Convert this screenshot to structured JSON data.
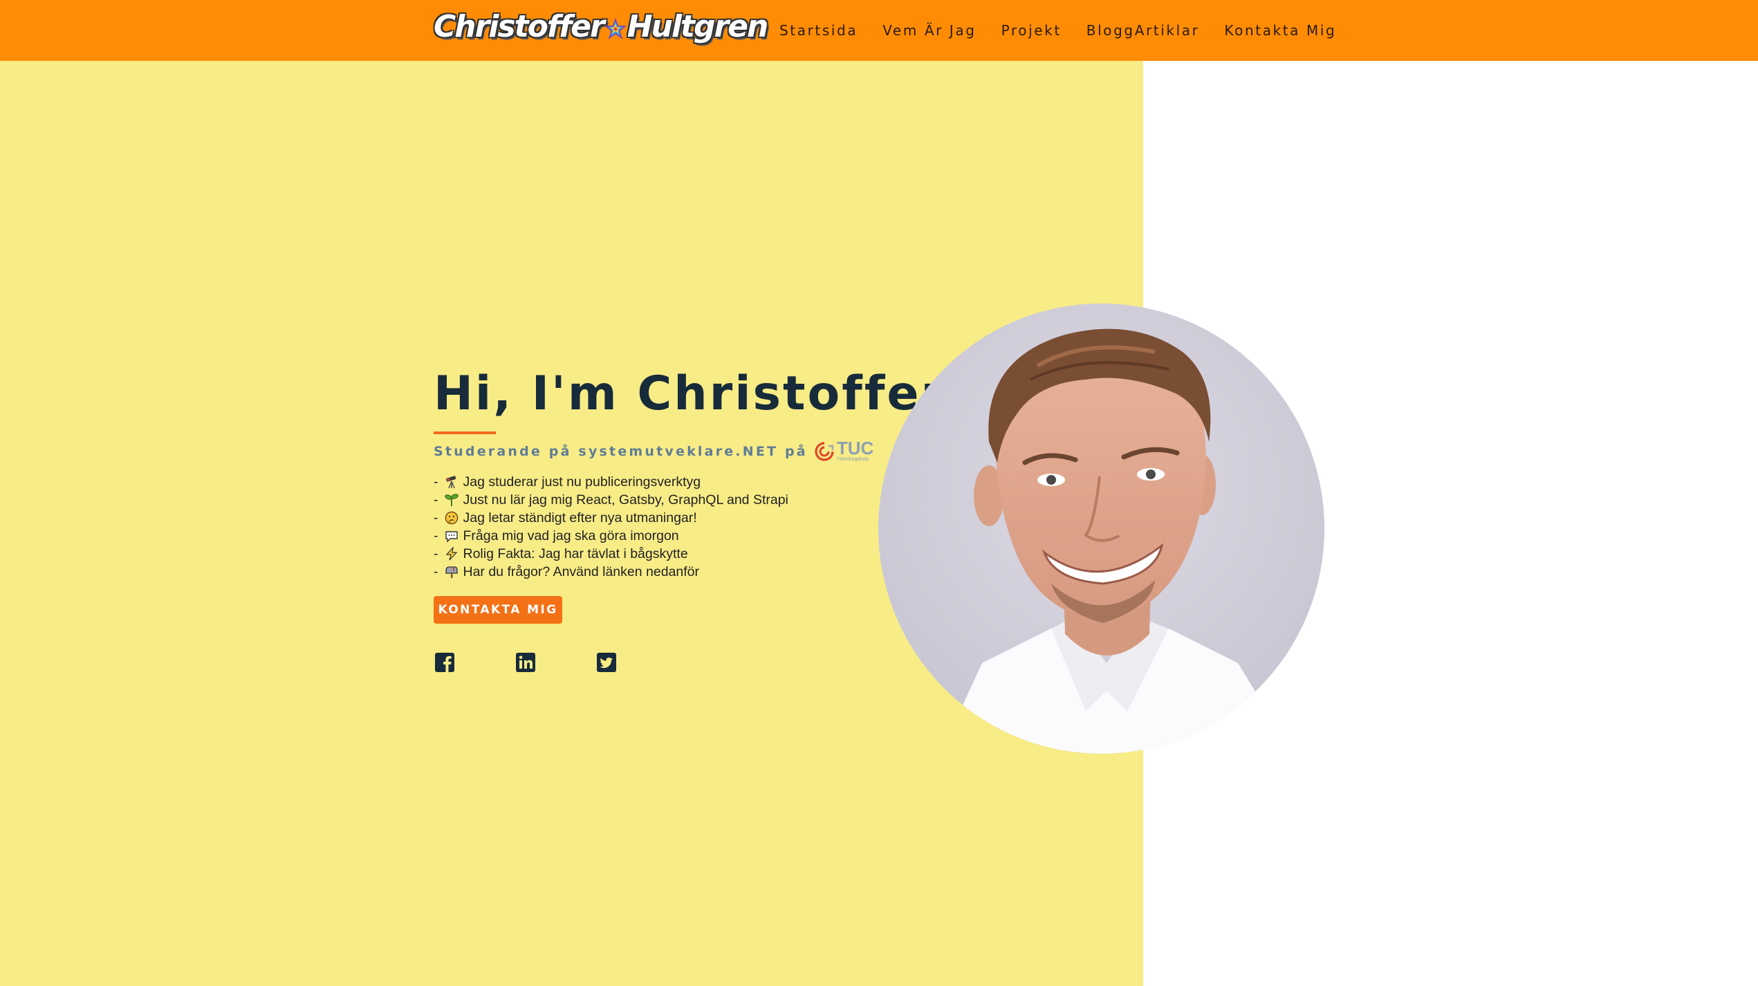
{
  "logo": {
    "left_text": "Christoffer",
    "right_text": "Hultgren",
    "icon": "rainbow-star-icon"
  },
  "nav": {
    "items": [
      {
        "label": "Startsida"
      },
      {
        "label": "Vem Är Jag"
      },
      {
        "label": "Projekt"
      },
      {
        "label": "BloggArtiklar"
      },
      {
        "label": "Kontakta Mig"
      }
    ]
  },
  "hero": {
    "title": "Hi, I'm Christoffer",
    "subtitle": "Studerande på systemutveklare.NET på",
    "school_logo": {
      "name": "TUC",
      "sub": "Yrkeshögskola"
    },
    "bullets": [
      {
        "text": "Jag studerar just nu publiceringsverktyg",
        "icon": "telescope-icon"
      },
      {
        "text": "Just nu lär jag mig React, Gatsby, GraphQL and Strapi",
        "icon": "seedling-icon"
      },
      {
        "text": "Jag letar ständigt efter nya utmaningar!",
        "icon": "thinking-face-icon"
      },
      {
        "text": "Fråga mig vad jag ska göra imorgon",
        "icon": "speech-bubble-icon"
      },
      {
        "text": "Rolig Fakta: Jag har tävlat i bågskytte",
        "icon": "lightning-icon"
      },
      {
        "text": "Har du frågor? Använd länken nedanför",
        "icon": "mailbox-icon"
      }
    ],
    "bullet_prefix": "-",
    "cta_label": "KONTAKTA MIG",
    "social": [
      "facebook-icon",
      "linkedin-icon",
      "twitter-icon"
    ]
  },
  "colors": {
    "header": "#ff8c04",
    "hero_bg": "#f8ec87",
    "title": "#172b3a",
    "accent": "#f47116",
    "subtitle": "#5f7c96"
  }
}
